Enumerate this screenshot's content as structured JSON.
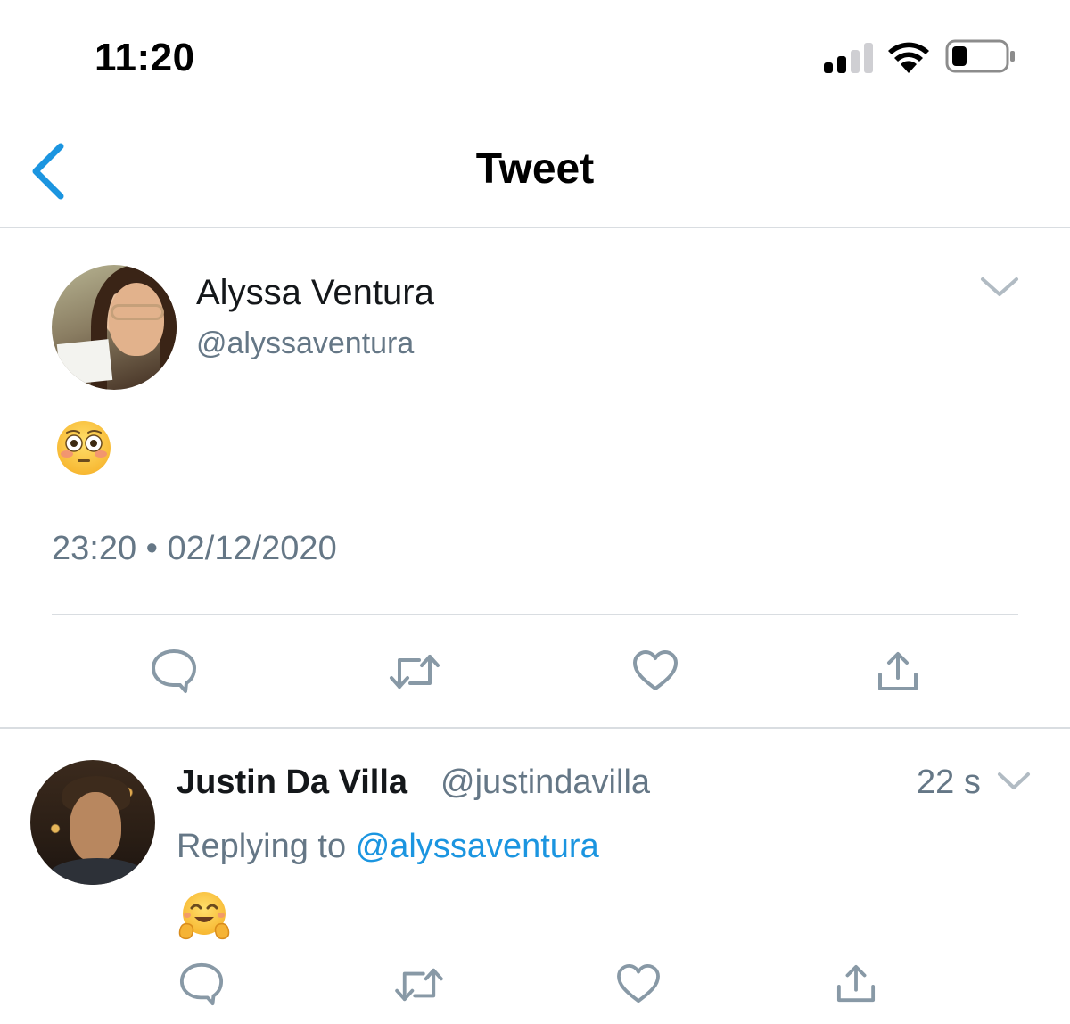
{
  "status_bar": {
    "time": "11:20",
    "icons": [
      "cellular-signal-icon",
      "wifi-icon",
      "battery-icon"
    ]
  },
  "nav": {
    "back_icon": "chevron-left-icon",
    "title": "Tweet"
  },
  "main_tweet": {
    "author_name": "Alyssa Ventura",
    "author_handle": "@alyssaventura",
    "content_emoji": "flushed-face-emoji",
    "timestamp": "23:20 • 02/12/2020",
    "actions": [
      "reply-icon",
      "retweet-icon",
      "like-icon",
      "share-icon"
    ]
  },
  "reply_tweet": {
    "author_name": "Justin Da Villa",
    "author_handle": "@justindavilla",
    "time_ago": "22 s",
    "replying_prefix": "Replying to",
    "replying_to": "@alyssaventura",
    "content_emoji": "hugging-face-emoji",
    "actions": [
      "reply-icon",
      "retweet-icon",
      "like-icon",
      "share-icon"
    ]
  },
  "colors": {
    "accent_blue": "#1b95e0",
    "secondary_text": "#657786",
    "icon_gray": "#8899a6",
    "divider": "#d9dde1"
  }
}
